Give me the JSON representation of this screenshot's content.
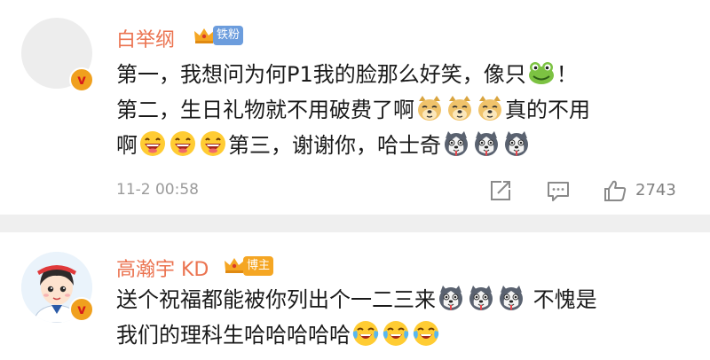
{
  "colors": {
    "username": "#eb7350",
    "fan_tag": "#6c9ddd",
    "host_tag": "#f5a623",
    "meta": "#9b9b9b"
  },
  "comments": [
    {
      "username": "白举纲",
      "tag": "铁粉",
      "line1_a": "第一，我想问为何P1我的脸那么好笑，像只",
      "line1_b": "！",
      "line2_a": "第二，生日礼物就不用破费了啊",
      "line2_b": "真的不用",
      "line3_a": "啊",
      "line3_b": "第三，谢谢你，哈士奇",
      "timestamp": "11-2 00:58",
      "likes": "2743",
      "emojis": [
        "frog-emoji",
        "doge-emoji",
        "grin-emoji",
        "husky-emoji"
      ]
    },
    {
      "username": "高瀚宇 KD",
      "tag": "博主",
      "line1_a": "送个祝福都能被你列出个一二三来",
      "line1_b": "不愧是",
      "line2_a": "我们的理科生哈哈哈哈哈",
      "emojis": [
        "husky-emoji",
        "laugh-cry-emoji"
      ]
    }
  ]
}
